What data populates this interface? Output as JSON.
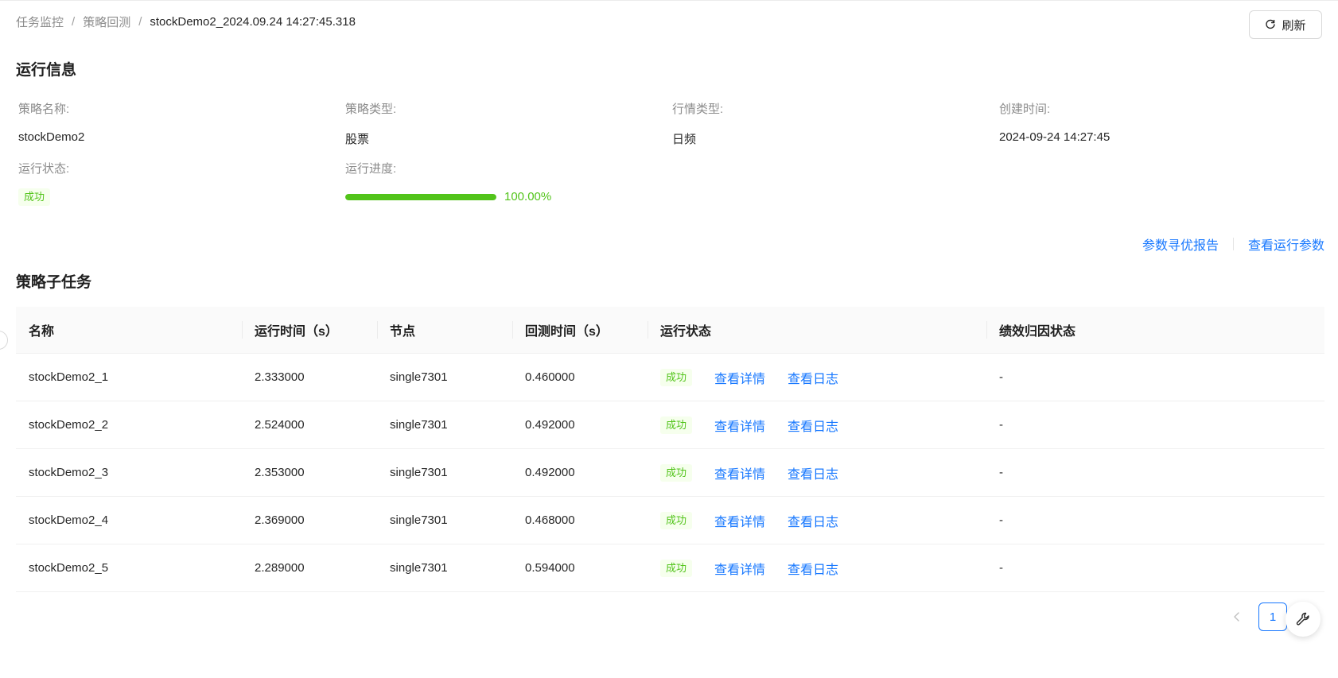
{
  "breadcrumb": {
    "items": [
      "任务监控",
      "策略回测"
    ],
    "separator": "/",
    "current": "stockDemo2_2024.09.24 14:27:45.318"
  },
  "header": {
    "refresh_label": "刷新",
    "refresh_icon": "reload-icon"
  },
  "run_info": {
    "title": "运行信息",
    "strategy_name_label": "策略名称:",
    "strategy_name": "stockDemo2",
    "strategy_type_label": "策略类型:",
    "strategy_type": "股票",
    "market_type_label": "行情类型:",
    "market_type": "日频",
    "created_time_label": "创建时间:",
    "created_time": "2024-09-24 14:27:45",
    "status_label": "运行状态:",
    "status": "成功",
    "progress_label": "运行进度:",
    "progress_text": "100.00%",
    "progress_fraction": 1.0
  },
  "actions": {
    "param_report": "参数寻优报告",
    "view_params": "查看运行参数"
  },
  "subtasks": {
    "title": "策略子任务",
    "columns": [
      "名称",
      "运行时间（s）",
      "节点",
      "回测时间（s）",
      "运行状态",
      "绩效归因状态"
    ],
    "view_detail_label": "查看详情",
    "view_log_label": "查看日志",
    "rows": [
      {
        "name": "stockDemo2_1",
        "run_time": "2.333000",
        "node": "single7301",
        "backtest_time": "0.460000",
        "status": "成功",
        "attribution": "-"
      },
      {
        "name": "stockDemo2_2",
        "run_time": "2.524000",
        "node": "single7301",
        "backtest_time": "0.492000",
        "status": "成功",
        "attribution": "-"
      },
      {
        "name": "stockDemo2_3",
        "run_time": "2.353000",
        "node": "single7301",
        "backtest_time": "0.492000",
        "status": "成功",
        "attribution": "-"
      },
      {
        "name": "stockDemo2_4",
        "run_time": "2.369000",
        "node": "single7301",
        "backtest_time": "0.468000",
        "status": "成功",
        "attribution": "-"
      },
      {
        "name": "stockDemo2_5",
        "run_time": "2.289000",
        "node": "single7301",
        "backtest_time": "0.594000",
        "status": "成功",
        "attribution": "-"
      }
    ]
  },
  "pagination": {
    "current_page": "1"
  },
  "colors": {
    "primary": "#1677ff",
    "success": "#52c41a",
    "success_bg": "#f6ffed"
  }
}
